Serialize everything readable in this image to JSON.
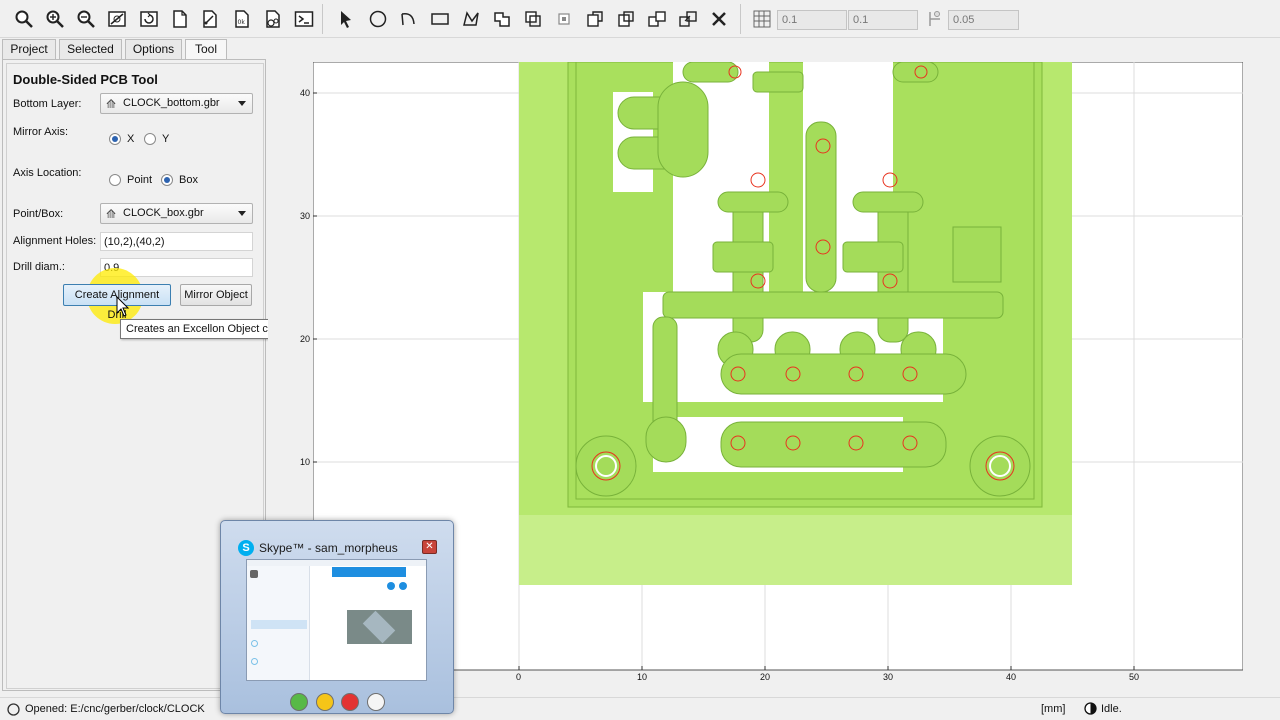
{
  "toolbar": {
    "icons": [
      "zoom-fit-icon",
      "zoom-in-icon",
      "zoom-out-icon",
      "clear-plot-icon",
      "replot-icon",
      "new-geometry-icon",
      "new-gerber-icon",
      "new-excellon-icon",
      "new-cnc-icon",
      "shell-icon",
      "select-icon",
      "circle-icon",
      "arc-icon",
      "rectangle-icon",
      "polygon-icon",
      "union-icon",
      "intersection-icon",
      "subtract-icon",
      "cut-icon",
      "copy-icon",
      "move-icon",
      "delete-icon"
    ],
    "grid_x": "0.1",
    "grid_y": "0.1",
    "snap_max": "0.05"
  },
  "tabs": [
    "Project",
    "Selected",
    "Options",
    "Tool"
  ],
  "active_tab": "Tool",
  "tool_panel": {
    "title": "Double-Sided PCB Tool",
    "bottom_layer_label": "Bottom Layer:",
    "bottom_layer_value": "CLOCK_bottom.gbr",
    "mirror_axis_label": "Mirror Axis:",
    "mirror_x": "X",
    "mirror_y": "Y",
    "mirror_axis_selected": "X",
    "axis_location_label": "Axis Location:",
    "axis_point": "Point",
    "axis_box": "Box",
    "axis_location_selected": "Box",
    "point_box_label": "Point/Box:",
    "point_box_value": "CLOCK_box.gbr",
    "alignment_holes_label": "Alignment Holes:",
    "alignment_holes_value": "(10,2),(40,2)",
    "drill_diam_label": "Drill diam.:",
    "drill_diam_value": "0.9",
    "create_button": "Create Alignment Drill",
    "mirror_button": "Mirror Object",
    "tooltip": "Creates an Excellon Object containing the specified alignment holes and their mirror images."
  },
  "plot": {
    "x_ticks": [
      "0",
      "10",
      "20",
      "30",
      "40",
      "50"
    ],
    "y_ticks": [
      "10",
      "20",
      "30",
      "40"
    ],
    "colors": {
      "board": "#b5e96c",
      "copper": "#a4dc5a",
      "drill": "#e8331f",
      "background": "#ffffff"
    }
  },
  "status": {
    "message": "Opened: E:/cnc/gerber/clock/CLOCK",
    "units": "[mm]",
    "state": "Idle."
  },
  "skype": {
    "title": "Skype™ - sam_morpheus",
    "buttons": [
      "available",
      "away",
      "do-not-disturb",
      "invisible"
    ]
  }
}
